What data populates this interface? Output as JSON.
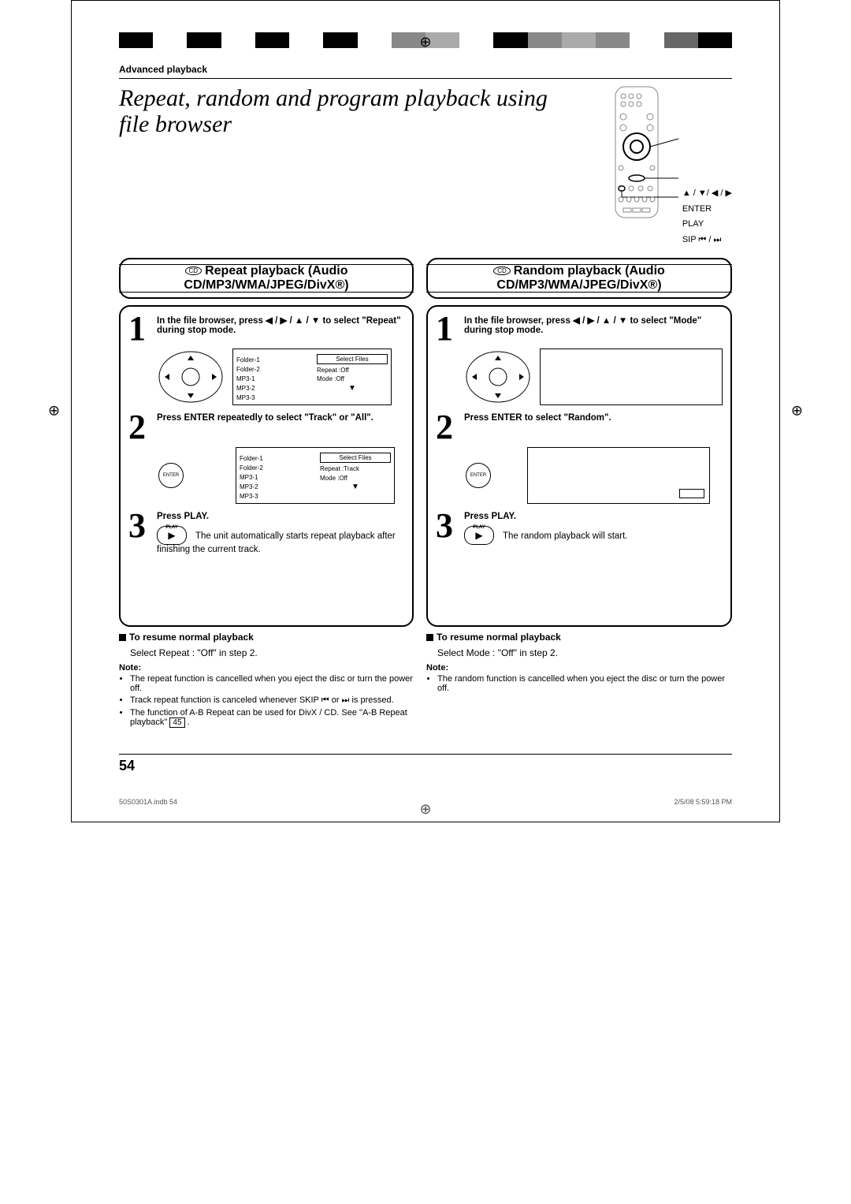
{
  "header": {
    "section": "Advanced playback"
  },
  "title": "Repeat, random and program playback using file browser",
  "remote_labels": {
    "arrows": "▲ / ▼/ ◀ / ▶",
    "enter": "ENTER",
    "play": "PLAY",
    "skip": "SIP  ⏮ / ⏭"
  },
  "left": {
    "cd_label": "CD",
    "heading": "Repeat playback (Audio CD/MP3/WMA/JPEG/DivX®)",
    "step1": "In the ﬁle browser, press ◀ / ▶ / ▲ / ▼ to select \"Repeat\" during stop mode.",
    "screen1": {
      "folders": [
        "Folder-1",
        "Folder-2",
        "MP3-1",
        "MP3-2",
        "MP3-3"
      ],
      "menu_title": "Select Files",
      "rows": [
        "Repeat    :Off",
        "Mode      :Off"
      ]
    },
    "step2": "Press ENTER repeatedly to select \"Track\" or \"All\".",
    "enter_label": "ENTER",
    "screen2": {
      "folders": [
        "Folder-1",
        "Folder-2",
        "MP3-1",
        "MP3-2",
        "MP3-3"
      ],
      "menu_title": "Select Files",
      "rows": [
        "Repeat    :Track",
        "Mode      :Off"
      ]
    },
    "step3_head": "Press PLAY.",
    "step3_body": "The unit automatically starts repeat playback after ﬁnishing the current track.",
    "resume_head": "To resume normal playback",
    "resume_body": "Select Repeat : \"Off\" in step 2.",
    "note_head": "Note:",
    "notes": [
      "The repeat function is cancelled when you eject the disc or turn the power off.",
      "Track repeat function is canceled whenever SKIP ⏮ or ⏭ is pressed.",
      "The function of A-B Repeat can be used for DivX / CD. See \"A-B Repeat playback\""
    ],
    "page_ref": "45"
  },
  "right": {
    "cd_label": "CD",
    "heading": "Random playback (Audio CD/MP3/WMA/JPEG/DivX®)",
    "step1": "In the ﬁle browser, press ◀ / ▶ / ▲ / ▼ to select \"Mode\" during stop mode.",
    "step2": "Press ENTER to select \"Random\".",
    "enter_label": "ENTER",
    "step3_head": "Press PLAY.",
    "step3_body": "The random playback will start.",
    "resume_head": "To resume normal playback",
    "resume_body": "Select Mode : \"Off\" in step 2.",
    "note_head": "Note:",
    "notes": [
      "The random function is cancelled when you eject the disc or turn the power off."
    ]
  },
  "page_number": "54",
  "footer": {
    "left": "50S0301A.indb   54",
    "right": "2/5/08   5:59:18 PM"
  }
}
